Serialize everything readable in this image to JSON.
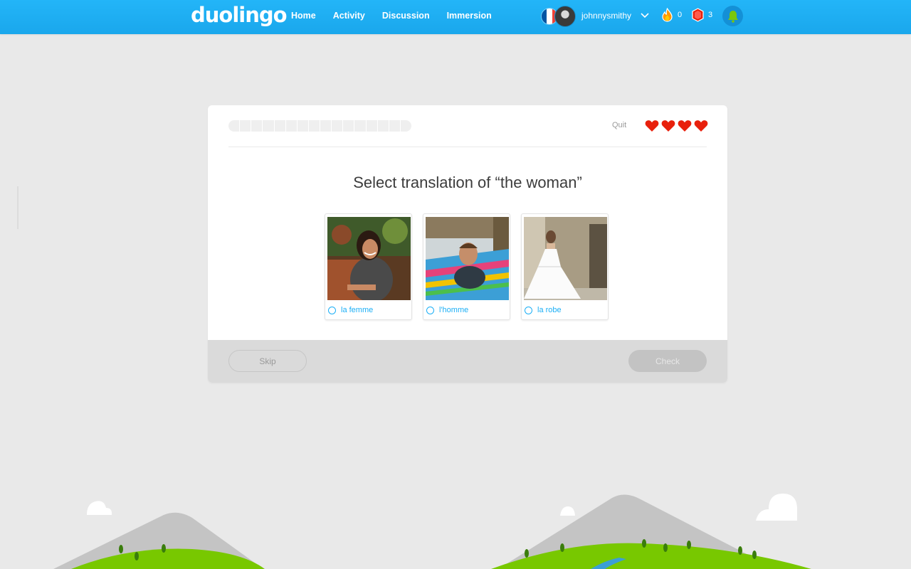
{
  "header": {
    "logo": "duolingo",
    "nav": [
      "Home",
      "Activity",
      "Discussion",
      "Immersion"
    ],
    "flag_colors": [
      "#0055a4",
      "#ffffff",
      "#ef4135"
    ],
    "username": "johnnysmithy",
    "streak_count": "0",
    "lingot_count": "3"
  },
  "lesson": {
    "quit_label": "Quit",
    "hearts": 4,
    "progress_fraction": 0,
    "progress_segments": 16,
    "prompt": "Select translation of “the woman”",
    "choices": [
      {
        "label": "la femme",
        "image": "photo-smiling-woman"
      },
      {
        "label": "l'homme",
        "image": "photo-man-in-hammock"
      },
      {
        "label": "la robe",
        "image": "photo-wedding-dress"
      }
    ],
    "skip_label": "Skip",
    "check_label": "Check"
  },
  "colors": {
    "brand_blue": "#1cb0f6",
    "heart_red": "#e8200c",
    "hill_green": "#78c800",
    "background": "#e9e9e9"
  }
}
